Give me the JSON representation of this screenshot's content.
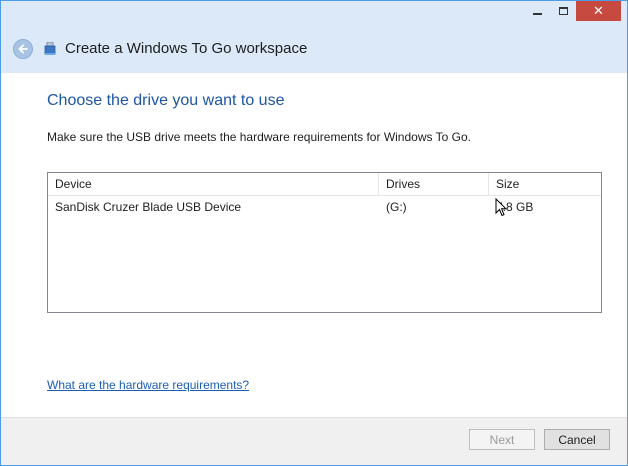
{
  "window": {
    "title": "Create a Windows To Go workspace",
    "caption": {
      "close_glyph": "✕"
    }
  },
  "page": {
    "heading": "Choose the drive you want to use",
    "instruction": "Make sure the USB drive meets the hardware requirements for Windows To Go."
  },
  "drive_list": {
    "columns": [
      "Device",
      "Drives",
      "Size"
    ],
    "rows": [
      {
        "device": "SanDisk Cruzer Blade USB Device",
        "drives": "(G:)",
        "size": "7.8 GB"
      }
    ]
  },
  "links": {
    "hardware_requirements": "What are the hardware requirements?"
  },
  "buttons": {
    "next": "Next",
    "cancel": "Cancel"
  },
  "colors": {
    "header_bg": "#dce9f8",
    "heading_blue": "#1d56a4",
    "link_blue": "#1a5fb4",
    "close_red": "#c74a40",
    "window_border": "#4f9be6"
  },
  "icons": [
    "back-arrow-icon",
    "usb-drive-icon",
    "minimize-icon",
    "maximize-icon",
    "close-icon",
    "mouse-cursor-icon"
  ]
}
